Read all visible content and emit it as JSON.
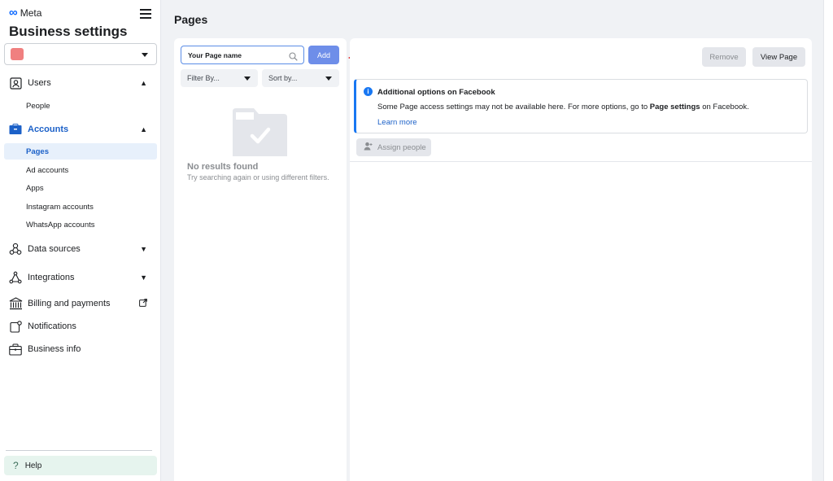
{
  "sidebar": {
    "brand": "Meta",
    "title": "Business settings",
    "business_swatch_color": "#f08080",
    "items": {
      "users": "Users",
      "people": "People",
      "accounts": "Accounts",
      "pages": "Pages",
      "ad_accounts": "Ad accounts",
      "apps": "Apps",
      "instagram": "Instagram accounts",
      "whatsapp": "WhatsApp accounts",
      "data_sources": "Data sources",
      "integrations": "Integrations",
      "billing": "Billing and payments",
      "notifications": "Notifications",
      "business_info": "Business info"
    },
    "help": "Help"
  },
  "main": {
    "title": "Pages",
    "left": {
      "search_value": "Your Page name",
      "add_label": "Add",
      "filter_label": "Filter By...",
      "sort_label": "Sort by...",
      "empty_title": "No results found",
      "empty_subtitle": "Try searching again or using different filters."
    },
    "right": {
      "remove_label": "Remove",
      "view_label": "View Page",
      "notice_title": "Additional options on Facebook",
      "notice_body_pre": "Some Page access settings may not be available here. For more options, go to ",
      "notice_body_bold": "Page settings",
      "notice_body_post": " on Facebook.",
      "notice_link": "Learn more",
      "assign_label": "Assign people"
    }
  },
  "colors": {
    "accent": "#1c61c8",
    "add_button": "#6e8ee9",
    "arrow": "#e00000"
  }
}
